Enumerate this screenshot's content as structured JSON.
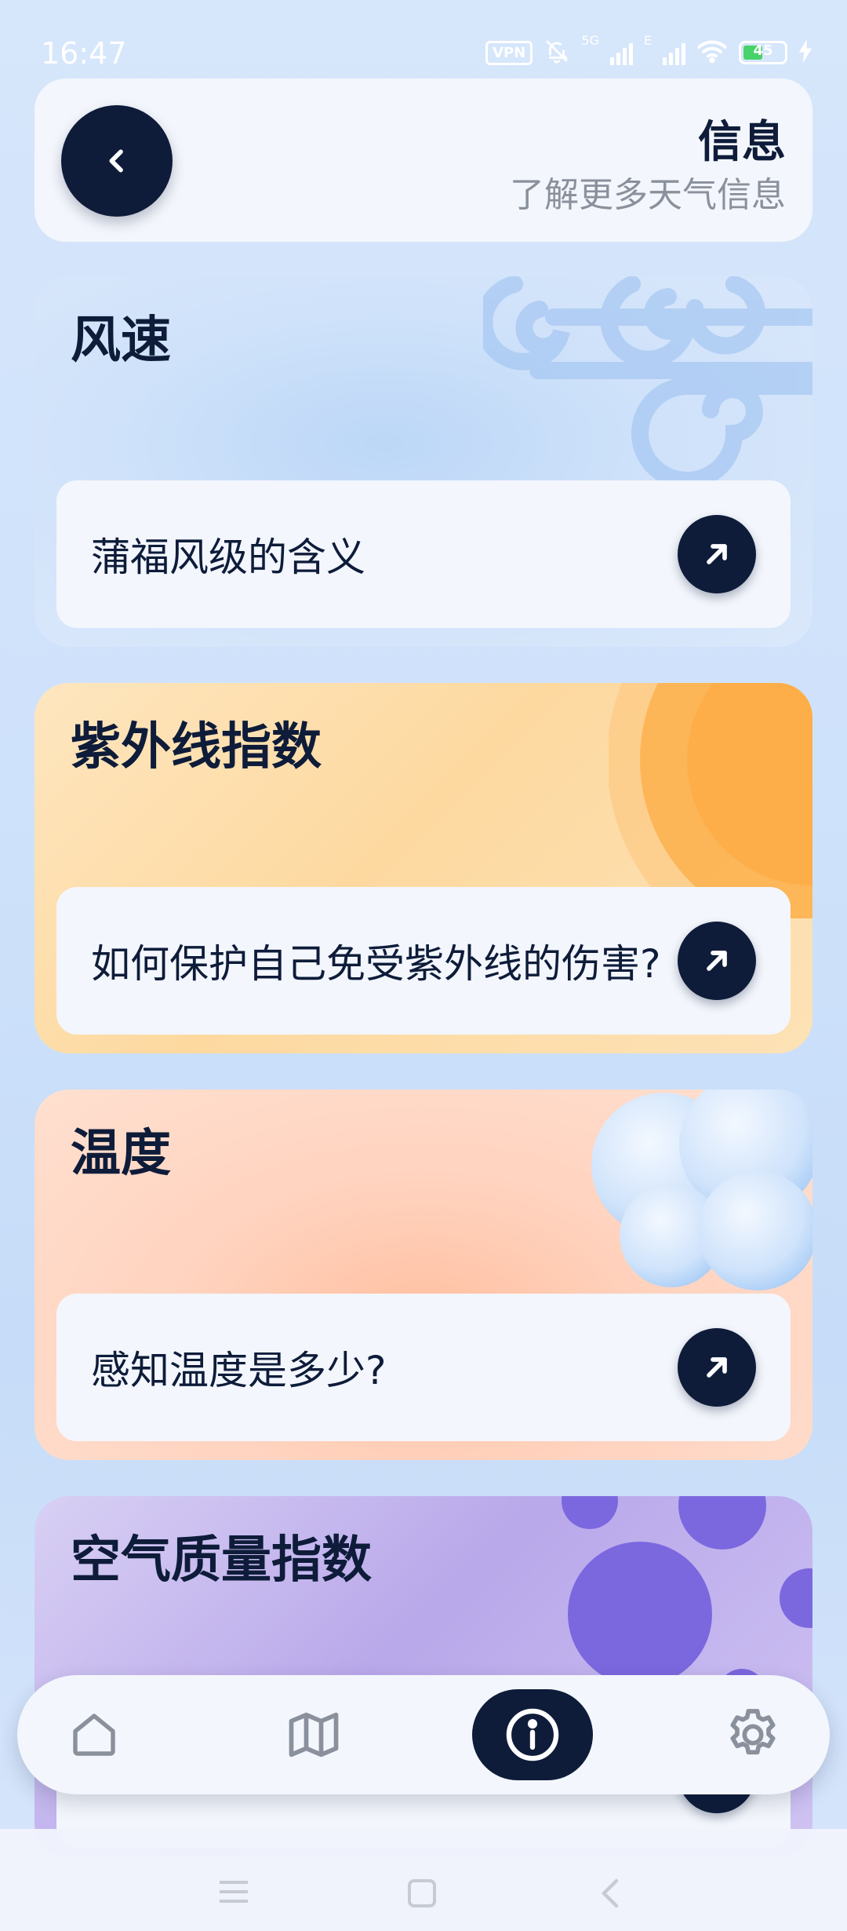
{
  "status_bar": {
    "time": "16:47",
    "vpn": "VPN",
    "network_1": "5G",
    "network_2": "E",
    "battery": "45"
  },
  "header": {
    "title": "信息",
    "subtitle": "了解更多天气信息"
  },
  "cards": [
    {
      "title": "风速",
      "link": "蒲福风级的含义",
      "theme": "wind",
      "accent": "#bcd7f7"
    },
    {
      "title": "紫外线指数",
      "link": "如何保护自己免受紫外线的伤害?",
      "theme": "sun",
      "accent": "#fdb34a"
    },
    {
      "title": "温度",
      "link": "感知温度是多少?",
      "theme": "cloud",
      "accent": "#ffbfa0"
    },
    {
      "title": "空气质量指数",
      "link": "",
      "theme": "particles",
      "accent": "#7b68df"
    }
  ],
  "bottom_nav": [
    {
      "icon": "home-icon",
      "active": false
    },
    {
      "icon": "map-icon",
      "active": false
    },
    {
      "icon": "info-icon",
      "active": true
    },
    {
      "icon": "settings-icon",
      "active": false
    }
  ],
  "colors": {
    "primary_dark": "#0e1c3a",
    "surface": "#f3f6fc",
    "muted_text": "#8a909c",
    "background": "#d6e6fb"
  }
}
